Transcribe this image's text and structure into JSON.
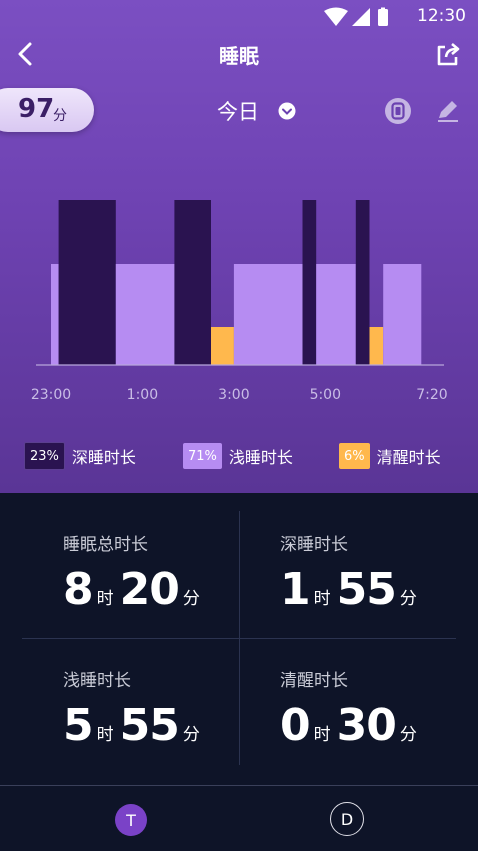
{
  "status_bar": {
    "time": "12:30"
  },
  "nav": {
    "title": "睡眠",
    "back_icon": "chevron-left-icon",
    "share_icon": "share-icon"
  },
  "score": {
    "value": "97",
    "unit": "分"
  },
  "day_selector": {
    "label": "今日",
    "icon": "chevron-down-circle-icon"
  },
  "toolbar": {
    "watch_icon": "watch-icon",
    "edit_icon": "pencil-icon"
  },
  "colors": {
    "deep": "#2a1350",
    "light": "#b68cf2",
    "awake": "#ffb84d"
  },
  "chart_data": {
    "type": "bar",
    "x_ticks": [
      "23:00",
      "1:00",
      "3:00",
      "5:00",
      "7:20"
    ],
    "x_range": [
      "23:00",
      "7:20"
    ],
    "stages": [
      {
        "stage": "light",
        "start": "23:00",
        "end": "23:10"
      },
      {
        "stage": "deep",
        "start": "23:10",
        "end": "0:25"
      },
      {
        "stage": "light",
        "start": "0:25",
        "end": "1:42"
      },
      {
        "stage": "deep",
        "start": "1:42",
        "end": "2:30"
      },
      {
        "stage": "awake",
        "start": "2:30",
        "end": "3:00"
      },
      {
        "stage": "light",
        "start": "3:00",
        "end": "4:30"
      },
      {
        "stage": "deep",
        "start": "4:30",
        "end": "4:48"
      },
      {
        "stage": "light",
        "start": "4:48",
        "end": "5:40"
      },
      {
        "stage": "deep",
        "start": "5:40",
        "end": "5:58"
      },
      {
        "stage": "awake",
        "start": "5:58",
        "end": "6:16"
      },
      {
        "stage": "light",
        "start": "6:16",
        "end": "7:06"
      }
    ],
    "levels": {
      "deep": 3,
      "light": 2,
      "awake": 1
    }
  },
  "legend": [
    {
      "pct": "23%",
      "label": "深睡时长"
    },
    {
      "pct": "71%",
      "label": "浅睡时长"
    },
    {
      "pct": "6%",
      "label": "清醒时长"
    }
  ],
  "stats": {
    "total": {
      "title": "睡眠总时长",
      "hours": "8",
      "hour_unit": "时",
      "minutes": "20",
      "minute_unit": "分"
    },
    "deep": {
      "title": "深睡时长",
      "hours": "1",
      "hour_unit": "时",
      "minutes": "55",
      "minute_unit": "分"
    },
    "light": {
      "title": "浅睡时长",
      "hours": "5",
      "hour_unit": "时",
      "minutes": "55",
      "minute_unit": "分"
    },
    "awake": {
      "title": "清醒时长",
      "hours": "0",
      "hour_unit": "时",
      "minutes": "30",
      "minute_unit": "分"
    }
  },
  "bottom_tabs": {
    "t_label": "T",
    "d_label": "D"
  }
}
